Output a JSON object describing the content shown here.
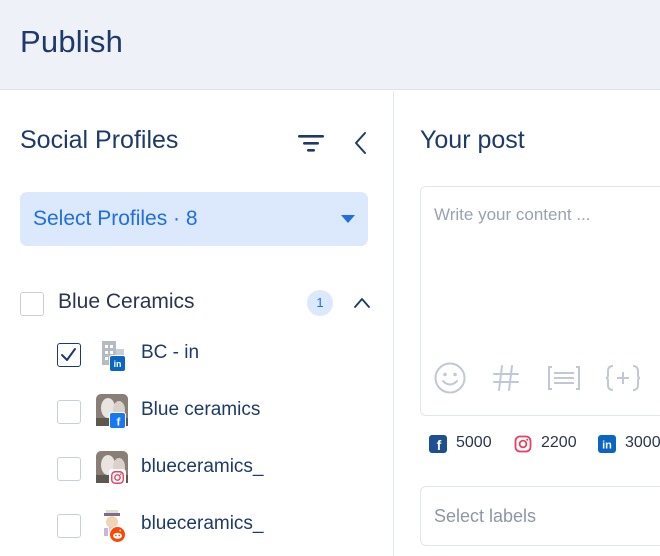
{
  "header": {
    "title": "Publish"
  },
  "sidebar": {
    "title": "Social Profiles",
    "select_profiles_label": "Select Profiles · 8",
    "group": {
      "name": "Blue Ceramics",
      "selected_count": "1"
    },
    "profiles": [
      {
        "name": "BC - in",
        "network": "linkedin",
        "checked": true
      },
      {
        "name": "Blue ceramics",
        "network": "facebook",
        "checked": false
      },
      {
        "name": "blueceramics_",
        "network": "instagram",
        "checked": false
      },
      {
        "name": "blueceramics_",
        "network": "reddit",
        "checked": false
      }
    ]
  },
  "post": {
    "title": "Your post",
    "content_placeholder": "Write your content ...",
    "tools": [
      "emoji-icon",
      "hashtag-icon",
      "snippet-icon",
      "variable-icon"
    ],
    "limits": [
      {
        "network": "facebook",
        "value": "5000"
      },
      {
        "network": "instagram",
        "value": "2200"
      },
      {
        "network": "linkedin",
        "value": "3000"
      }
    ],
    "labels_placeholder": "Select labels"
  },
  "colors": {
    "accent": "#1f6fe0",
    "heading": "#1d3a6b",
    "facebook": "#1877f2",
    "instagram": "#e4405f",
    "linkedin": "#0a66c2",
    "reddit": "#ff4500"
  }
}
